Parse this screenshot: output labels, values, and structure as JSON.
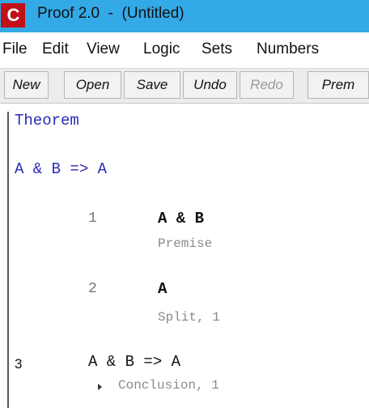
{
  "window": {
    "app_icon_text": "C",
    "title": "Proof 2.0  -  (Untitled)",
    "title_bar_color": "#33a9e6",
    "icon_color": "#c21018"
  },
  "menu": {
    "items": [
      "File",
      "Edit",
      "View",
      "Logic",
      "Sets",
      "Numbers"
    ]
  },
  "toolbar": {
    "buttons": [
      {
        "label": "New",
        "enabled": true
      },
      {
        "label": "Open",
        "enabled": true
      },
      {
        "label": "Save",
        "enabled": true
      },
      {
        "label": "Undo",
        "enabled": true
      },
      {
        "label": "Redo",
        "enabled": false
      },
      {
        "label": "Prem",
        "enabled": true
      }
    ]
  },
  "proof": {
    "heading": "Theorem",
    "heading_color": "#2a2ab8",
    "theorem": "A & B => A",
    "steps": [
      {
        "number": "1",
        "expression": "A & B",
        "justification": "Premise"
      },
      {
        "number": "2",
        "expression": "A",
        "justification": "Split, 1"
      }
    ],
    "conclusion": {
      "number": "3",
      "expression": "A & B => A",
      "justification": "Conclusion, 1",
      "expander_icon": "triangle-right-icon"
    }
  }
}
